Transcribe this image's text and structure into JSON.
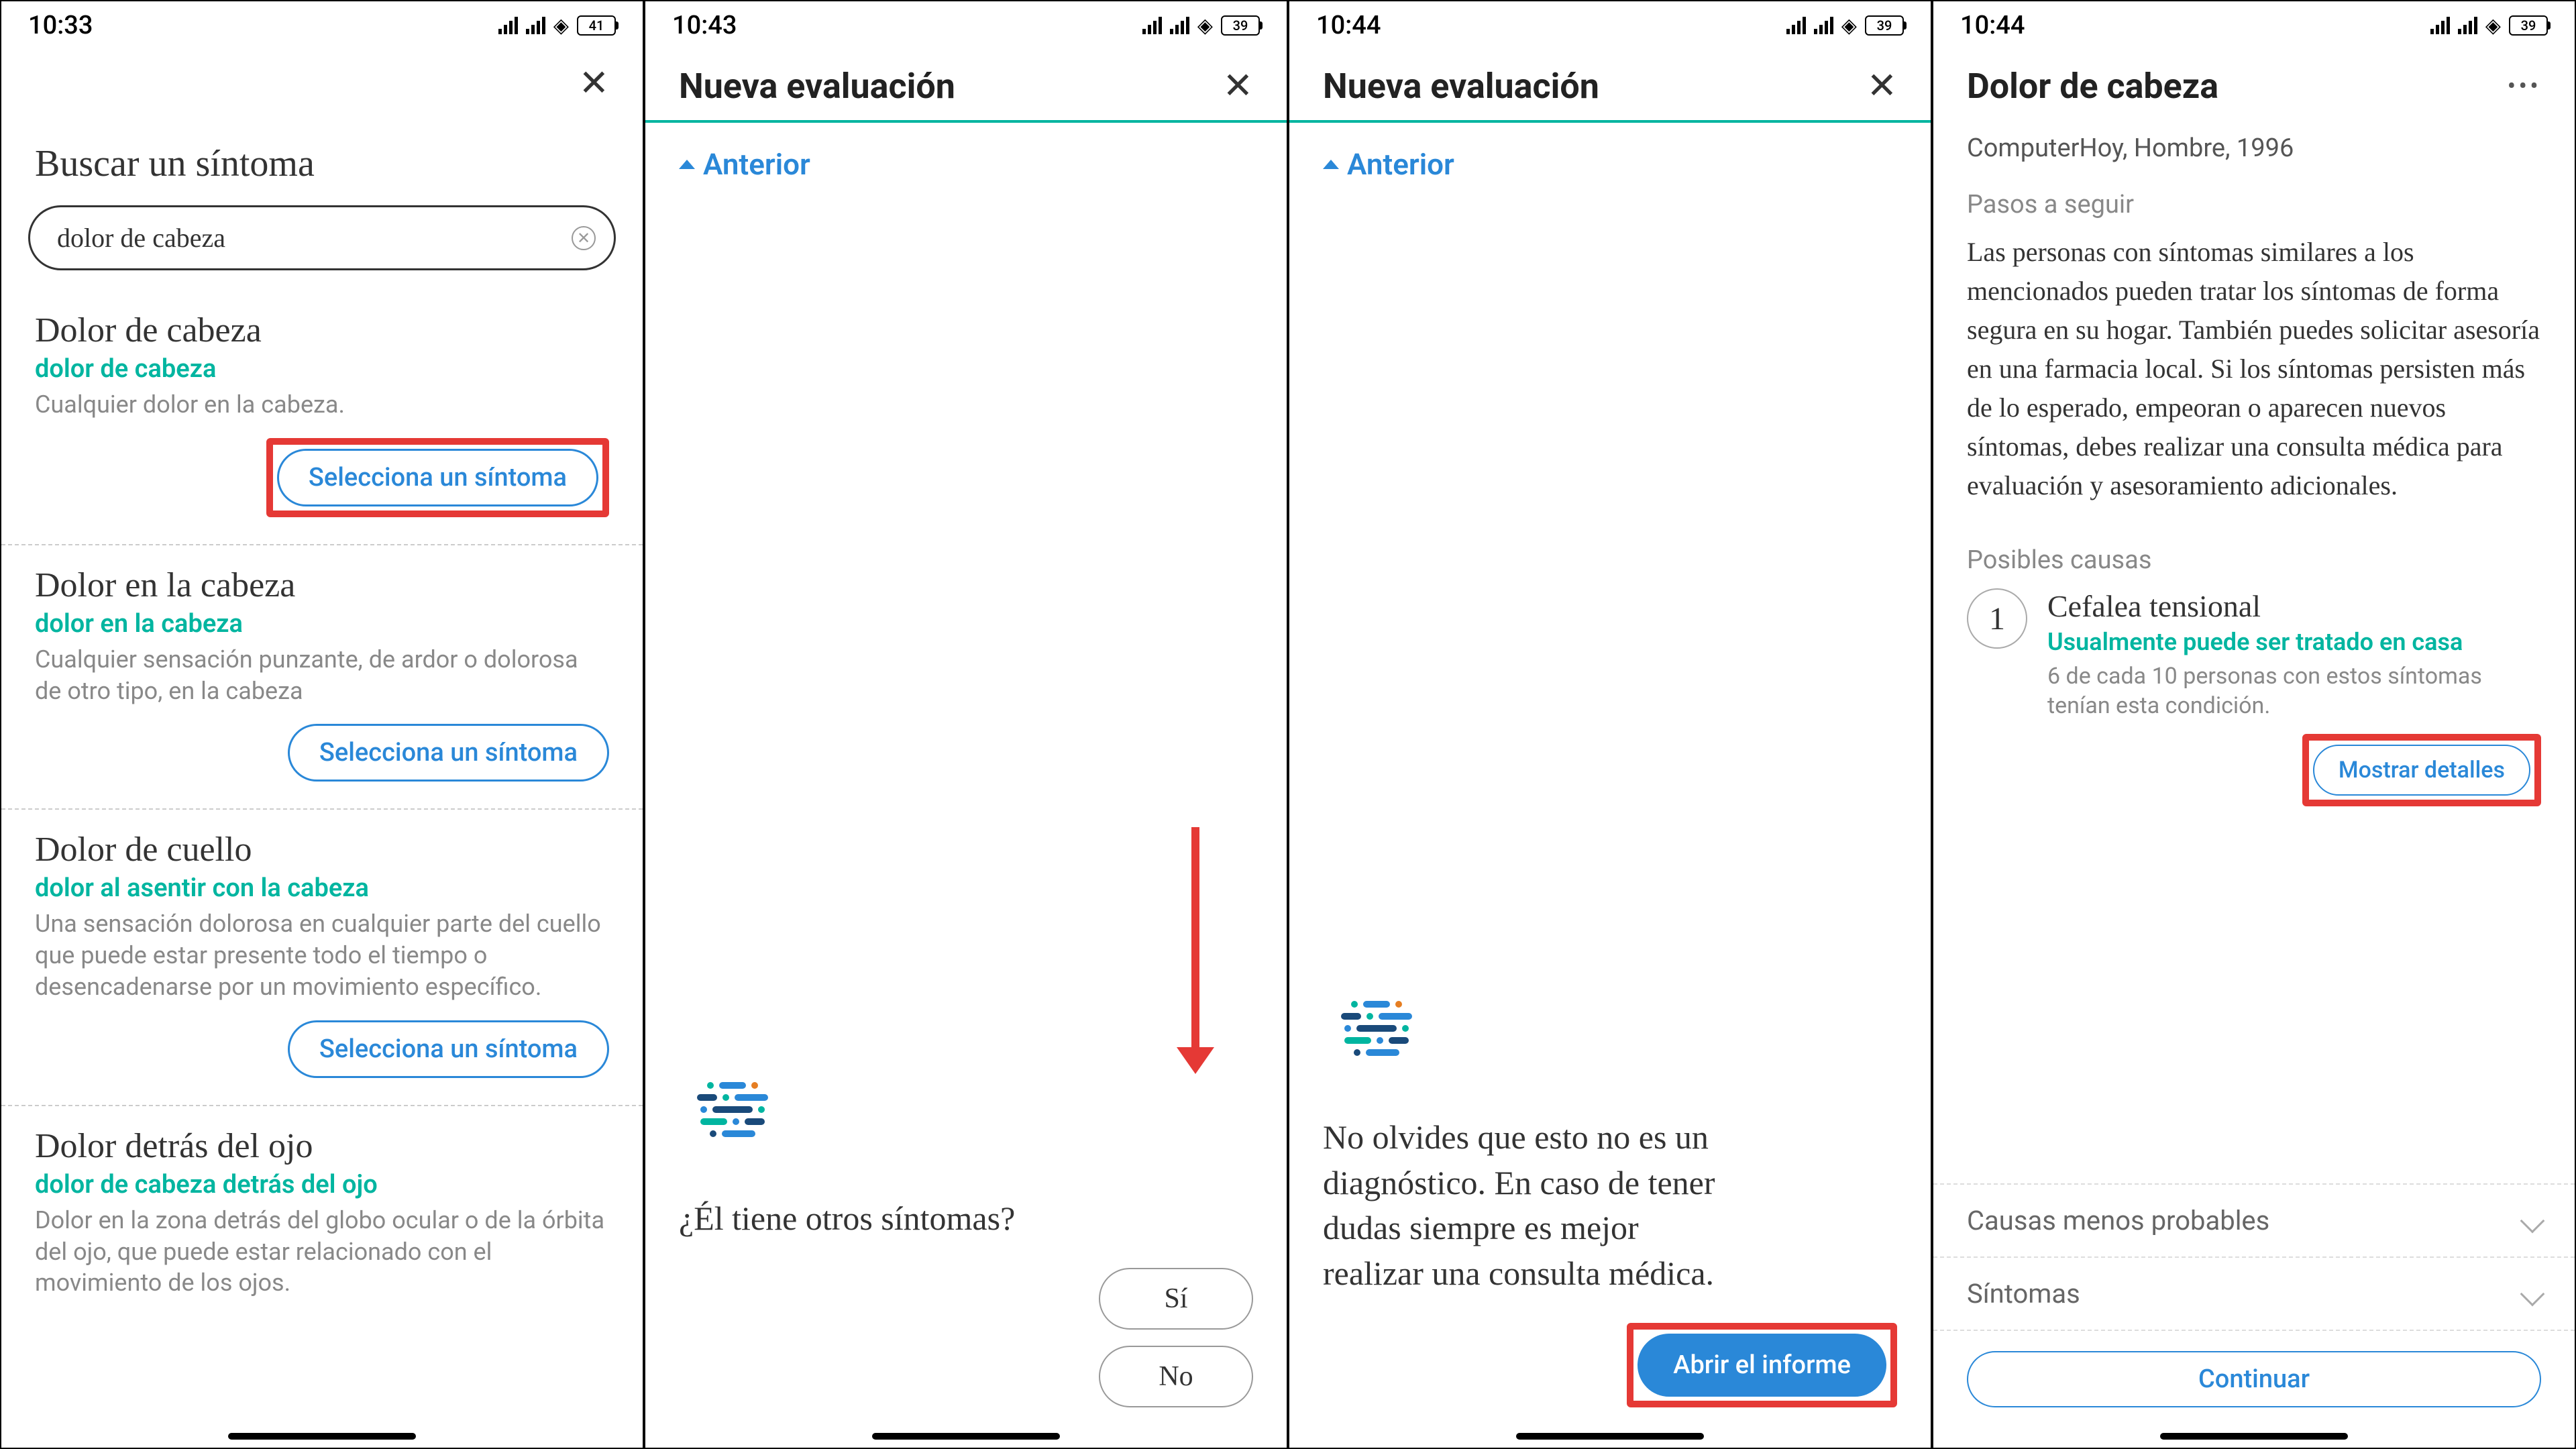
{
  "screens": {
    "s1": {
      "time": "10:33",
      "battery": "41",
      "close": "✕",
      "title": "Buscar un síntoma",
      "search_value": "dolor de cabeza",
      "results": [
        {
          "title": "Dolor de cabeza",
          "sub": "dolor de cabeza",
          "desc": "Cualquier dolor en la cabeza.",
          "btn": "Selecciona un síntoma",
          "highlight": true
        },
        {
          "title": "Dolor en la cabeza",
          "sub": "dolor en la cabeza",
          "desc": "Cualquier sensación punzante, de ardor o dolorosa de otro tipo, en la cabeza",
          "btn": "Selecciona un síntoma",
          "highlight": false
        },
        {
          "title": "Dolor de cuello",
          "sub": "dolor al asentir con la cabeza",
          "desc": "Una sensación dolorosa en cualquier parte del cuello que puede estar presente todo el tiempo o desencadenarse por un movimiento específico.",
          "btn": "Selecciona un síntoma",
          "highlight": false
        },
        {
          "title": "Dolor detrás del ojo",
          "sub": "dolor de cabeza detrás del ojo",
          "desc": "Dolor en la zona detrás del globo ocular o de la órbita del ojo, que puede estar relacionado con el movimiento de los ojos.",
          "btn": "",
          "highlight": false
        }
      ]
    },
    "s2": {
      "time": "10:43",
      "battery": "39",
      "title": "Nueva evaluación",
      "close": "✕",
      "anterior": "Anterior",
      "question": "¿Él tiene otros síntomas?",
      "yes": "Sí",
      "no": "No"
    },
    "s3": {
      "time": "10:44",
      "battery": "39",
      "title": "Nueva evaluación",
      "close": "✕",
      "anterior": "Anterior",
      "question": "No olvides que esto no es un diagnóstico. En caso de tener dudas siempre es mejor realizar una consulta médica.",
      "cta": "Abrir el informe"
    },
    "s4": {
      "time": "10:44",
      "battery": "39",
      "title": "Dolor de cabeza",
      "more": "•••",
      "meta": "ComputerHoy, Hombre, 1996",
      "steps_label": "Pasos a seguir",
      "body": "Las personas con síntomas similares a los mencionados pueden tratar los síntomas de forma segura en su hogar. También puedes solicitar asesoría en una farmacia local. Si los síntomas persisten más de lo esperado, empeoran o aparecen nuevos síntomas, debes realizar una consulta médica para evaluación y asesoramiento adicionales.",
      "causes_label": "Posibles causas",
      "cause": {
        "num": "1",
        "title": "Cefalea tensional",
        "sub": "Usualmente puede ser tratado en casa",
        "desc": "6 de cada 10 personas con estos síntomas tenían esta condición.",
        "btn": "Mostrar detalles"
      },
      "acc1": "Causas menos probables",
      "acc2": "Síntomas",
      "continue": "Continuar"
    }
  }
}
